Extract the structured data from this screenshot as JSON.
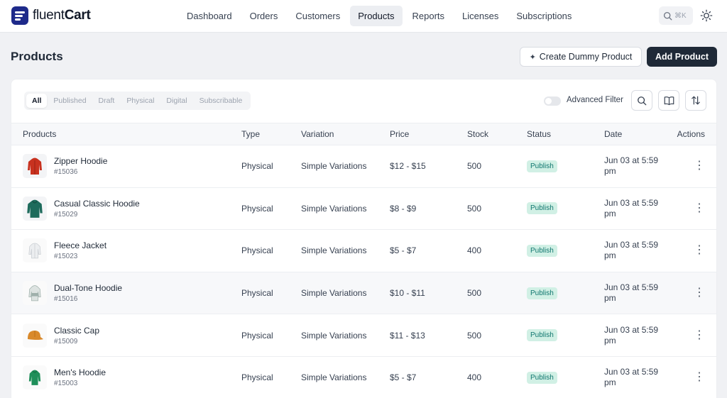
{
  "brand": {
    "name_light": "fluent",
    "name_bold": "Cart"
  },
  "nav": [
    {
      "label": "Dashboard",
      "active": false
    },
    {
      "label": "Orders",
      "active": false
    },
    {
      "label": "Customers",
      "active": false
    },
    {
      "label": "Products",
      "active": true
    },
    {
      "label": "Reports",
      "active": false
    },
    {
      "label": "Licenses",
      "active": false
    },
    {
      "label": "Subscriptions",
      "active": false
    }
  ],
  "search": {
    "shortcut": "⌘K",
    "icon": "search-icon"
  },
  "theme_toggle": {
    "icon": "sun-icon"
  },
  "header": {
    "title": "Products",
    "dummy_button": "Create Dummy Product",
    "add_button": "Add Product"
  },
  "filters": {
    "tabs": [
      "All",
      "Published",
      "Draft",
      "Physical",
      "Digital",
      "Subscribable"
    ],
    "active": "All",
    "advanced_filter_label": "Advanced Filter",
    "advanced_filter_enabled": false
  },
  "table": {
    "columns": [
      "Products",
      "Type",
      "Variation",
      "Price",
      "Stock",
      "Status",
      "Date",
      "Actions"
    ],
    "rows": [
      {
        "name": "Zipper Hoodie",
        "id": "#15036",
        "type": "Physical",
        "variation": "Simple Variations",
        "price": "$12 - $15",
        "stock": "500",
        "status": "Publish",
        "date": "Jun 03 at 5:59 pm",
        "thumb_color": "#c8321f"
      },
      {
        "name": "Casual Classic Hoodie",
        "id": "#15029",
        "type": "Physical",
        "variation": "Simple Variations",
        "price": "$8 - $9",
        "stock": "500",
        "status": "Publish",
        "date": "Jun 03 at 5:59 pm",
        "thumb_color": "#1e6b5c"
      },
      {
        "name": "Fleece Jacket",
        "id": "#15023",
        "type": "Physical",
        "variation": "Simple Variations",
        "price": "$5 - $7",
        "stock": "400",
        "status": "Publish",
        "date": "Jun 03 at 5:59 pm",
        "thumb_color": "#e9ebee"
      },
      {
        "name": "Dual-Tone Hoodie",
        "id": "#15016",
        "type": "Physical",
        "variation": "Simple Variations",
        "price": "$10 - $11",
        "stock": "500",
        "status": "Publish",
        "date": "Jun 03 at 5:59 pm",
        "thumb_color": "#b8c4c0"
      },
      {
        "name": "Classic Cap",
        "id": "#15009",
        "type": "Physical",
        "variation": "Simple Variations",
        "price": "$11 - $13",
        "stock": "500",
        "status": "Publish",
        "date": "Jun 03 at 5:59 pm",
        "thumb_color": "#d9892b"
      },
      {
        "name": "Men's Hoodie",
        "id": "#15003",
        "type": "Physical",
        "variation": "Simple Variations",
        "price": "$5 - $7",
        "stock": "400",
        "status": "Publish",
        "date": "Jun 03 at 5:59 pm",
        "thumb_color": "#1f8f5a"
      }
    ]
  },
  "colors": {
    "accent": "#1f2937",
    "brand": "#1e2a8a",
    "status_publish_bg": "#d1f0e5",
    "status_publish_text": "#0f766e"
  }
}
